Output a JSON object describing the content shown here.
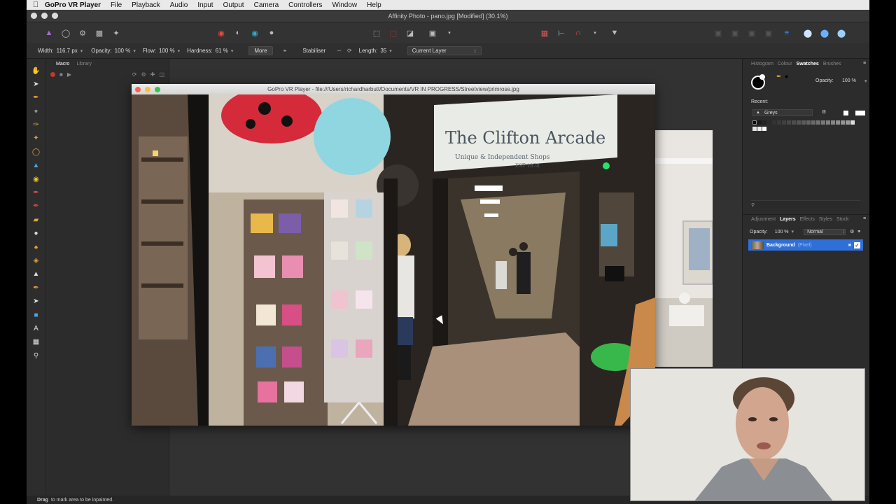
{
  "menubar": {
    "app_name": "GoPro VR Player",
    "items": [
      "File",
      "Playback",
      "Audio",
      "Input",
      "Output",
      "Camera",
      "Controllers",
      "Window",
      "Help"
    ]
  },
  "window": {
    "title": "Affinity Photo - pano.jpg [Modified] (30.1%)"
  },
  "context_toolbar": {
    "width_label": "Width:",
    "width_value": "116.7 px",
    "opacity_label": "Opacity:",
    "opacity_value": "100 %",
    "flow_label": "Flow:",
    "flow_value": "100 %",
    "hardness_label": "Hardness:",
    "hardness_value": "61 %",
    "more_label": "More",
    "stabiliser_label": "Stabiliser",
    "length_label": "Length:",
    "length_value": "35",
    "layer_select": "Current Layer"
  },
  "macro_panel": {
    "tabs": [
      "Macro",
      "Library"
    ]
  },
  "gopro_window": {
    "title": "GoPro VR Player - file:///Users/richardharbutt/Documents/VR IN PROGRESS/Streetview/primrose.jpg",
    "sign_line1": "The Clifton Arcade",
    "sign_line2": "Unique & Independent Shops",
    "sign_line3": "EST 1878"
  },
  "right_panel": {
    "top_tabs": [
      "Histogram",
      "Colour",
      "Swatches",
      "Brushes"
    ],
    "active_top_tab": "Swatches",
    "opacity_label": "Opacity:",
    "opacity_value": "100 %",
    "recent_label": "Recent:",
    "palette_name": "Greys",
    "layer_tabs": [
      "Adjustment",
      "Layers",
      "Effects",
      "Styles",
      "Stock"
    ],
    "active_layer_tab": "Layers",
    "layer_opacity_label": "Opacity:",
    "layer_opacity_value": "100 %",
    "blend_mode": "Normal",
    "layer_name": "Background",
    "layer_type": "(Pixel)"
  },
  "status": {
    "bold": "Drag",
    "text": "to mark area to be inpainted."
  },
  "colors": {
    "selection_blue": "#2f6fd8",
    "record_red": "#c0392b",
    "close_red": "#fc605c",
    "minimize_yellow": "#fdbc40",
    "zoom_green": "#34c84a"
  }
}
